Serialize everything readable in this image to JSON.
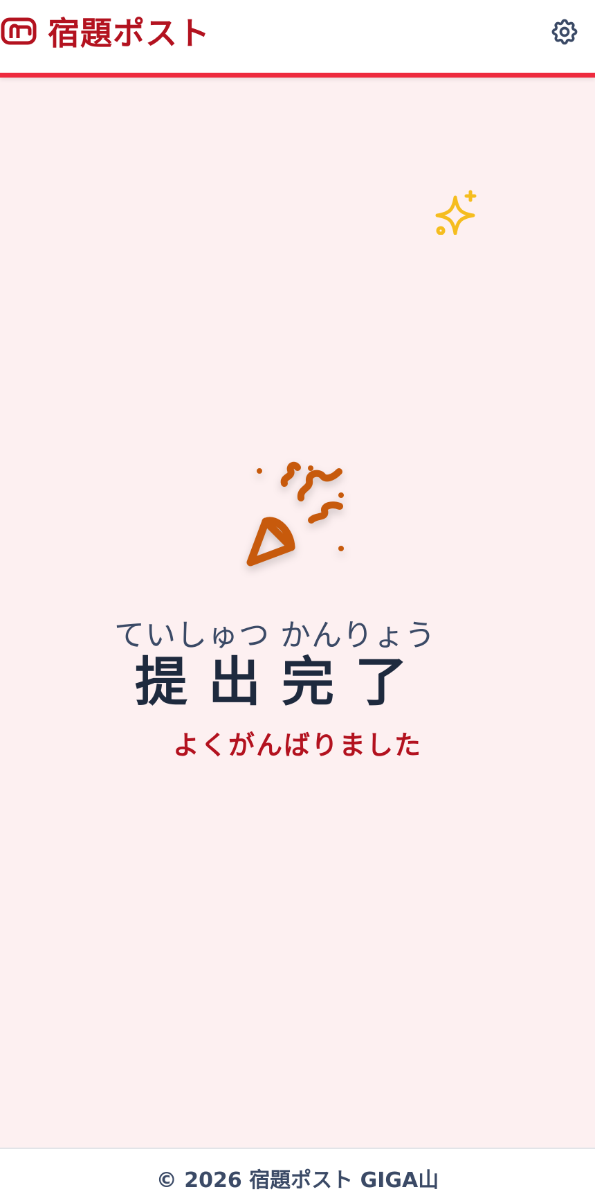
{
  "header": {
    "app_title": "宿題ポスト",
    "brand_icon": "mailbox-icon",
    "settings_icon": "gear-icon"
  },
  "completion": {
    "icon": "party-popper-icon",
    "reading": "ていしゅつ かんりょう",
    "title": "提出完了",
    "decoration_icon": "sparkle-icon",
    "message": "よくがんばりました"
  },
  "footer": {
    "copyright": "© 2026 宿題ポスト GIGA山"
  },
  "colors": {
    "brand": "#b3121f",
    "accent_bar": "#ee2a3e",
    "background": "#fdf0f1",
    "popper": "#c75a0c",
    "sparkle": "#f5bd1f",
    "title_text": "#1e2a3e"
  }
}
